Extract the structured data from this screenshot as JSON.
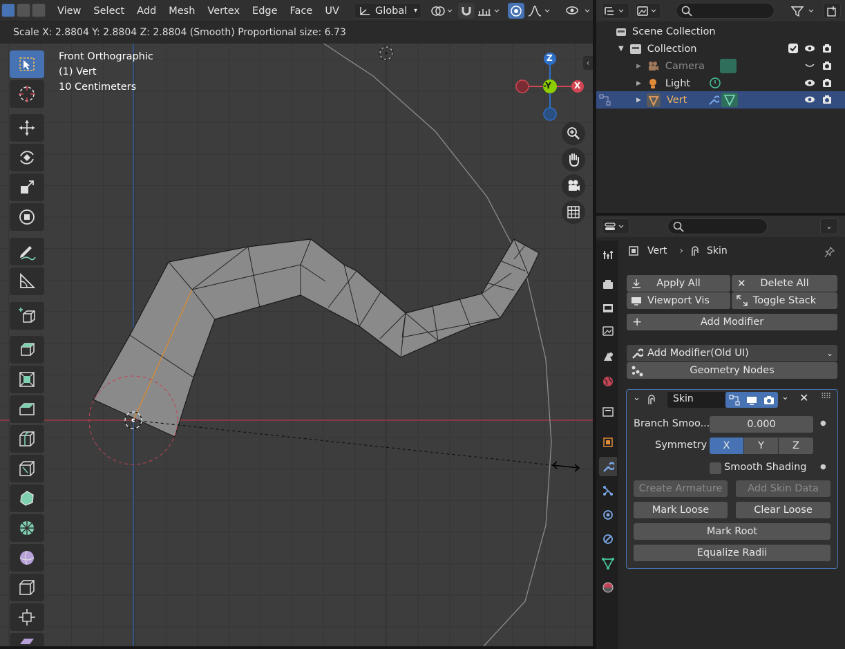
{
  "header": {
    "menus": [
      "View",
      "Select",
      "Add",
      "Mesh",
      "Vertex",
      "Edge",
      "Face",
      "UV"
    ],
    "orientation": "Global"
  },
  "viewport": {
    "status": "Scale X: 2.8804   Y: 2.8804   Z: 2.8804 (Smooth) Proportional size: 6.73",
    "view_name": "Front Orthographic",
    "object_info": "(1) Vert",
    "scale_info": "10 Centimeters",
    "gizmo": {
      "z": "Z",
      "y": "-Y",
      "x": "X"
    }
  },
  "outliner": {
    "root": "Scene Collection",
    "collection": "Collection",
    "items": [
      {
        "label": "Camera",
        "dimmed": true
      },
      {
        "label": "Light",
        "dimmed": false
      },
      {
        "label": "Vert",
        "selected": true
      }
    ]
  },
  "properties": {
    "breadcrumb_object": "Vert",
    "breadcrumb_modifier": "Skin",
    "buttons": {
      "apply_all": "Apply All",
      "delete_all": "Delete All",
      "viewport_vis": "Viewport Vis",
      "toggle_stack": "Toggle Stack",
      "add_modifier": "Add Modifier",
      "add_modifier_old": "Add Modifier(Old UI)",
      "geometry_nodes": "Geometry Nodes"
    },
    "modifier": {
      "name": "Skin",
      "branch_label": "Branch Smoo...",
      "branch_value": "0.000",
      "symmetry_label": "Symmetry",
      "sym_x": "X",
      "sym_y": "Y",
      "sym_z": "Z",
      "smooth_shading": "Smooth Shading",
      "create_armature": "Create Armature",
      "add_skin_data": "Add Skin Data",
      "mark_loose": "Mark Loose",
      "clear_loose": "Clear Loose",
      "mark_root": "Mark Root",
      "equalize_radii": "Equalize Radii"
    }
  },
  "colors": {
    "accent": "#4772b3",
    "selected_row": "#334d80",
    "x_axis": "#d14652",
    "y_axis": "#8ccd00",
    "z_axis": "#2e70c8",
    "mesh": "#8a8a8a"
  }
}
